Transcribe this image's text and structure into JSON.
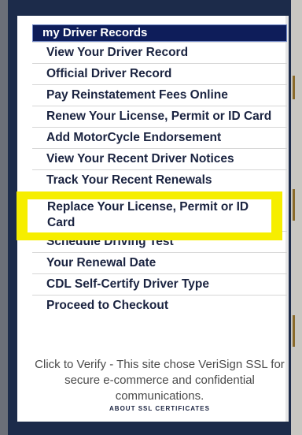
{
  "panel": {
    "header": "my Driver Records",
    "items": [
      {
        "label": "View Your Driver Record"
      },
      {
        "label": "Official Driver Record"
      },
      {
        "label": "Pay Reinstatement Fees Online"
      },
      {
        "label": "Renew Your License, Permit or ID Card"
      },
      {
        "label": "Add MotorCycle Endorsement"
      },
      {
        "label": "View Your Recent Driver Notices"
      },
      {
        "label": "Track Your Recent Renewals"
      }
    ],
    "highlighted_item": {
      "label": "Replace Your License, Permit or ID Card"
    },
    "items_after": [
      {
        "label": "Schedule Driving Test"
      },
      {
        "label": "Your Renewal Date"
      },
      {
        "label": "CDL Self-Certify Driver Type"
      },
      {
        "label": "Proceed to Checkout"
      }
    ],
    "ssl_notice": "Click to Verify - This site chose VeriSign SSL for secure e-commerce and confidential communications.",
    "ssl_link": "ABOUT SSL CERTIFICATES"
  },
  "colors": {
    "header_bg": "#0e1d5a",
    "highlight": "#f6ee00",
    "frame": "#1c2b4a",
    "link_text": "#1a2340"
  }
}
